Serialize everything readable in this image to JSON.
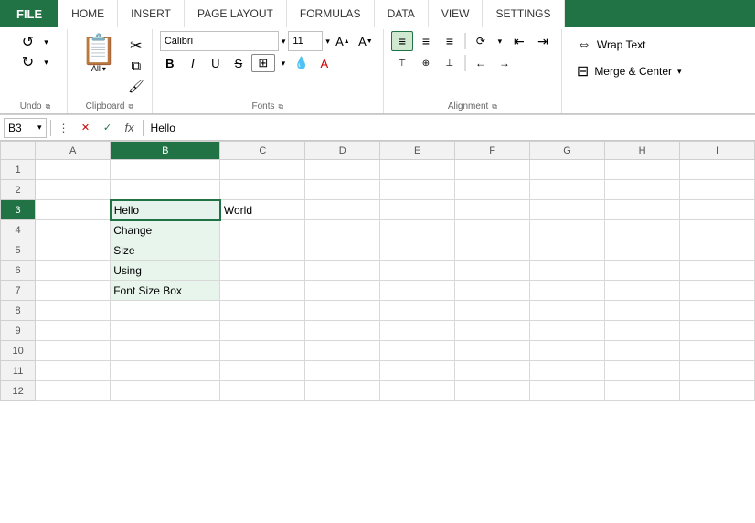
{
  "tabs": {
    "file": "FILE",
    "items": [
      "HOME",
      "INSERT",
      "PAGE LAYOUT",
      "FORMULAS",
      "DATA",
      "VIEW",
      "SETTINGS"
    ]
  },
  "ribbon": {
    "undo_label": "Undo",
    "clipboard_label": "Clipboard",
    "fonts_label": "Fonts",
    "alignment_label": "Alignment",
    "font_name": "Calibri",
    "font_size": "11",
    "bold": "B",
    "italic": "I",
    "underline": "U",
    "wrap_text": "Wrap Text",
    "merge_center": "Merge & Center"
  },
  "formula_bar": {
    "cell_ref": "B3",
    "formula_value": "Hello",
    "cancel_icon": "✕",
    "confirm_icon": "✓",
    "fx_label": "fx"
  },
  "columns": [
    "A",
    "B",
    "C",
    "D",
    "E",
    "F",
    "G",
    "H",
    "I"
  ],
  "rows": [
    1,
    2,
    3,
    4,
    5,
    6,
    7,
    8,
    9,
    10,
    11,
    12
  ],
  "cells": {
    "B3": "Hello",
    "C3": "World",
    "B4": "Change",
    "B5": "Size",
    "B6": "Using",
    "B7": "Font Size Box"
  },
  "active_cell": "B3",
  "active_col": "B",
  "active_row": 3
}
